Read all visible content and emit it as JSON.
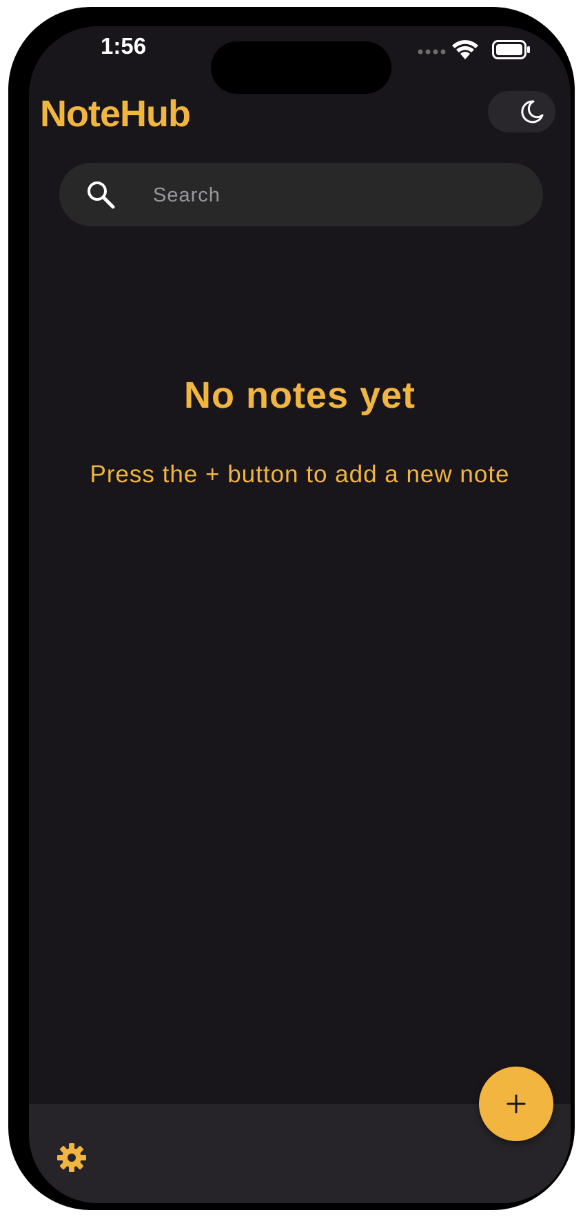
{
  "status_bar": {
    "time": "1:56"
  },
  "header": {
    "title": "NoteHub",
    "theme_toggle_icon": "moon-icon"
  },
  "search": {
    "placeholder": "Search",
    "value": "",
    "icon": "search-icon"
  },
  "empty_state": {
    "title": "No notes yet",
    "subtitle": "Press the + button to add a new note"
  },
  "bottom_bar": {
    "settings_icon": "gear-icon"
  },
  "fab": {
    "icon": "plus-icon"
  },
  "colors": {
    "accent": "#f2b53f",
    "background": "#18151b",
    "search_bg": "#282828",
    "bottom_bar_bg": "#262428"
  }
}
